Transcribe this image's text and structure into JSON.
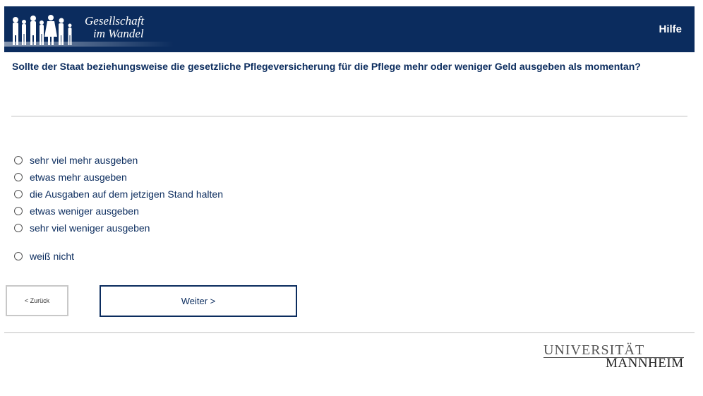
{
  "header": {
    "logo_line1": "Gesellschaft",
    "logo_line2": "im Wandel",
    "help_label": "Hilfe"
  },
  "question": "Sollte der Staat beziehungsweise die gesetzliche Pflegeversicherung für die Pflege mehr oder weniger Geld ausgeben als momentan?",
  "options": [
    {
      "label": "sehr viel mehr ausgeben",
      "selected": false
    },
    {
      "label": "etwas mehr ausgeben",
      "selected": false
    },
    {
      "label": "die Ausgaben auf dem jetzigen Stand halten",
      "selected": false
    },
    {
      "label": "etwas weniger ausgeben",
      "selected": false
    },
    {
      "label": "sehr viel weniger ausgeben",
      "selected": false
    },
    {
      "label": "weiß nicht",
      "selected": false
    }
  ],
  "nav": {
    "back_label": "< Zurück",
    "next_label": "Weiter >"
  },
  "footer": {
    "uni_line1": "UNIVERSITÄT",
    "uni_line2": "MANNHEIM"
  },
  "colors": {
    "brand": "#0b2c5e",
    "divider": "#c0c0c0"
  }
}
